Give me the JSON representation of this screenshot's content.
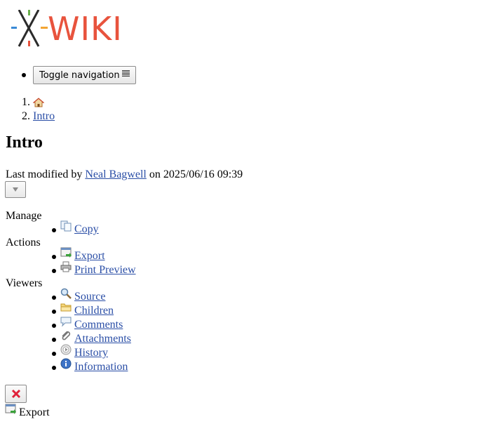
{
  "logo": {
    "wordmark": "WIKI"
  },
  "nav": {
    "toggle_label": "Toggle navigation"
  },
  "breadcrumb": {
    "items": [
      {
        "number": "1.",
        "label": ""
      },
      {
        "number": "2.",
        "label": "Intro"
      }
    ]
  },
  "page": {
    "title": "Intro",
    "last_modified_prefix": "Last modified by",
    "author": "Neal Bagwell",
    "on": "on",
    "date": "2025/06/16 09:39"
  },
  "menu": {
    "manage_label": "Manage",
    "actions_label": "Actions",
    "viewers_label": "Viewers",
    "manage_items": [
      {
        "label": "Copy",
        "icon": "copy-icon"
      }
    ],
    "actions_items": [
      {
        "label": "Export",
        "icon": "export-icon"
      },
      {
        "label": "Print Preview",
        "icon": "printer-icon"
      }
    ],
    "viewers_items": [
      {
        "label": "Source",
        "icon": "magnifier-icon"
      },
      {
        "label": "Children",
        "icon": "folder-icon"
      },
      {
        "label": "Comments",
        "icon": "comment-icon"
      },
      {
        "label": "Attachments",
        "icon": "paperclip-icon"
      },
      {
        "label": "History",
        "icon": "history-icon"
      },
      {
        "label": "Information",
        "icon": "info-icon"
      }
    ]
  },
  "footer": {
    "export_label": "Export"
  },
  "colors": {
    "link": "#2a4ea6",
    "close_x": "#e0213a",
    "logo_red": "#e8533d"
  }
}
